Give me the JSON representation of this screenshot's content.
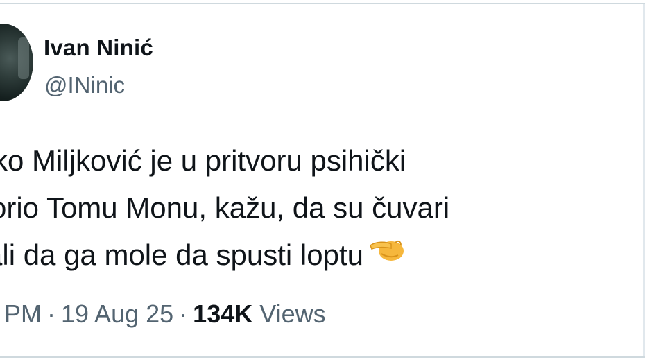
{
  "author": {
    "display_name": "Ivan Ninić",
    "handle": "@INinic"
  },
  "tweet": {
    "lines": [
      "ko Miljković je u pritvoru psihički",
      "orio Tomu Monu, kažu, da su čuvari",
      "ali da ga mole da spusti loptu"
    ],
    "emoji": "pinching-hand-icon"
  },
  "meta": {
    "time": "PM",
    "separator": "·",
    "date": "19 Aug 25",
    "views_count": "134K",
    "views_label": "Views"
  },
  "colors": {
    "text_primary": "#0f1419",
    "text_secondary": "#536471",
    "divider": "#cfd9de",
    "emoji_fill": "#f6b73c"
  }
}
